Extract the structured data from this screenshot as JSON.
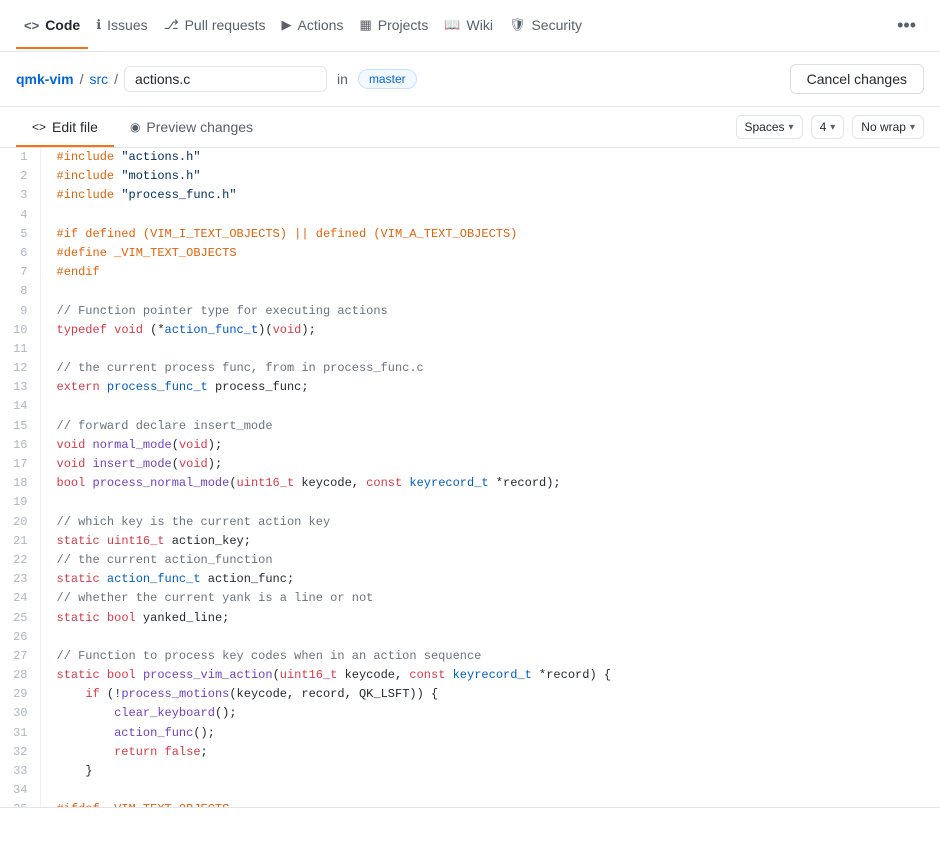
{
  "nav": {
    "items": [
      {
        "id": "code",
        "label": "Code",
        "icon": "<>",
        "active": true
      },
      {
        "id": "issues",
        "label": "Issues",
        "icon": "ℹ",
        "active": false
      },
      {
        "id": "pull-requests",
        "label": "Pull requests",
        "icon": "⎇",
        "active": false
      },
      {
        "id": "actions",
        "label": "Actions",
        "icon": "▶",
        "active": false
      },
      {
        "id": "projects",
        "label": "Projects",
        "icon": "▦",
        "active": false
      },
      {
        "id": "wiki",
        "label": "Wiki",
        "icon": "📖",
        "active": false
      },
      {
        "id": "security",
        "label": "Security",
        "icon": "🛡",
        "active": false
      }
    ],
    "more_icon": "•••"
  },
  "breadcrumb": {
    "repo": "qmk-vim",
    "sep1": "/",
    "folder": "src",
    "sep2": "/",
    "filename": "actions.c",
    "in_text": "in",
    "branch": "master",
    "cancel_label": "Cancel changes"
  },
  "editor": {
    "tabs": [
      {
        "id": "edit-file",
        "label": "Edit file",
        "icon": "<>",
        "active": true
      },
      {
        "id": "preview-changes",
        "label": "Preview changes",
        "icon": "◉",
        "active": false
      }
    ],
    "controls": {
      "indent_label": "Spaces",
      "indent_value": "4",
      "wrap_label": "No wrap"
    }
  },
  "lines": [
    {
      "num": 1,
      "code": "#include \"actions.h\"",
      "type": "pp"
    },
    {
      "num": 2,
      "code": "#include \"motions.h\"",
      "type": "pp"
    },
    {
      "num": 3,
      "code": "#include \"process_func.h\"",
      "type": "pp"
    },
    {
      "num": 4,
      "code": "",
      "type": "nm"
    },
    {
      "num": 5,
      "code": "#if defined (VIM_I_TEXT_OBJECTS) || defined (VIM_A_TEXT_OBJECTS)",
      "type": "pp"
    },
    {
      "num": 6,
      "code": "#define _VIM_TEXT_OBJECTS",
      "type": "pp"
    },
    {
      "num": 7,
      "code": "#endif",
      "type": "pp"
    },
    {
      "num": 8,
      "code": "",
      "type": "nm"
    },
    {
      "num": 9,
      "code": "// Function pointer type for executing actions",
      "type": "cm"
    },
    {
      "num": 10,
      "code": "typedef void (*action_func_t)(void);",
      "type": "nm"
    },
    {
      "num": 11,
      "code": "",
      "type": "nm"
    },
    {
      "num": 12,
      "code": "// the current process func, from in process_func.c",
      "type": "cm"
    },
    {
      "num": 13,
      "code": "extern process_func_t process_func;",
      "type": "nm"
    },
    {
      "num": 14,
      "code": "",
      "type": "nm"
    },
    {
      "num": 15,
      "code": "// forward declare insert_mode",
      "type": "cm"
    },
    {
      "num": 16,
      "code": "void normal_mode(void);",
      "type": "nm"
    },
    {
      "num": 17,
      "code": "void insert_mode(void);",
      "type": "nm"
    },
    {
      "num": 18,
      "code": "bool process_normal_mode(uint16_t keycode, const keyrecord_t *record);",
      "type": "nm"
    },
    {
      "num": 19,
      "code": "",
      "type": "nm"
    },
    {
      "num": 20,
      "code": "// which key is the current action key",
      "type": "cm"
    },
    {
      "num": 21,
      "code": "static uint16_t action_key;",
      "type": "nm"
    },
    {
      "num": 22,
      "code": "// the current action_function",
      "type": "cm"
    },
    {
      "num": 23,
      "code": "static action_func_t action_func;",
      "type": "nm"
    },
    {
      "num": 24,
      "code": "// whether the current yank is a line or not",
      "type": "cm"
    },
    {
      "num": 25,
      "code": "static bool yanked_line;",
      "type": "nm"
    },
    {
      "num": 26,
      "code": "",
      "type": "nm"
    },
    {
      "num": 27,
      "code": "// Function to process key codes when in an action sequence",
      "type": "cm"
    },
    {
      "num": 28,
      "code": "static bool process_vim_action(uint16_t keycode, const keyrecord_t *record) {",
      "type": "nm"
    },
    {
      "num": 29,
      "code": "    if (!process_motions(keycode, record, QK_LSFT)) {",
      "type": "nm"
    },
    {
      "num": 30,
      "code": "        clear_keyboard();",
      "type": "nm"
    },
    {
      "num": 31,
      "code": "        action_func();",
      "type": "nm"
    },
    {
      "num": 32,
      "code": "        return false;",
      "type": "nm"
    },
    {
      "num": 33,
      "code": "    }",
      "type": "nm"
    },
    {
      "num": 34,
      "code": "",
      "type": "nm"
    },
    {
      "num": 35,
      "code": "#ifdef _VIM_TEXT_OBJECTS",
      "type": "pp"
    }
  ]
}
